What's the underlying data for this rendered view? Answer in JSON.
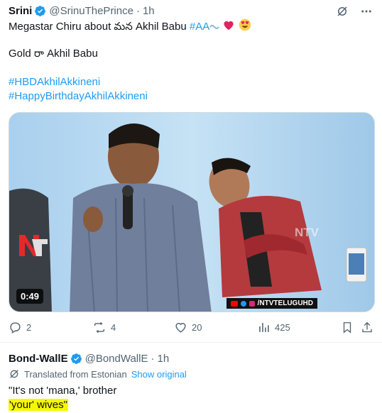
{
  "tweet1": {
    "name": "Srini",
    "handle": "@SrinuThePrince",
    "separator": "·",
    "time": "1h",
    "text_line1_prefix": "Megastar Chiru about మన Akhil Babu",
    "hashtag_aa": "#AA",
    "text_line2": "Gold రా Akhil Babu",
    "hashtag1": "#HBDAkhilAkkineni",
    "hashtag2": "#HappyBirthdayAkhilAkkineni",
    "media": {
      "duration": "0:49",
      "watermark": "/NTVTELUGUHD",
      "logo_text": "NTV"
    },
    "actions": {
      "replies": "2",
      "reposts": "4",
      "likes": "20",
      "views": "425"
    }
  },
  "tweet2": {
    "name": "Bond-WallE",
    "handle": "@BondWallE",
    "separator": "·",
    "time": "1h",
    "translated_label": "Translated from Estonian",
    "show_original": "Show original",
    "line1": "\"It's not 'mana,' brother",
    "line2": "'your' wives\""
  },
  "colors": {
    "accent": "#1d9bf0",
    "muted": "#536471",
    "highlight": "#f7f700",
    "heart": "#f91880"
  }
}
